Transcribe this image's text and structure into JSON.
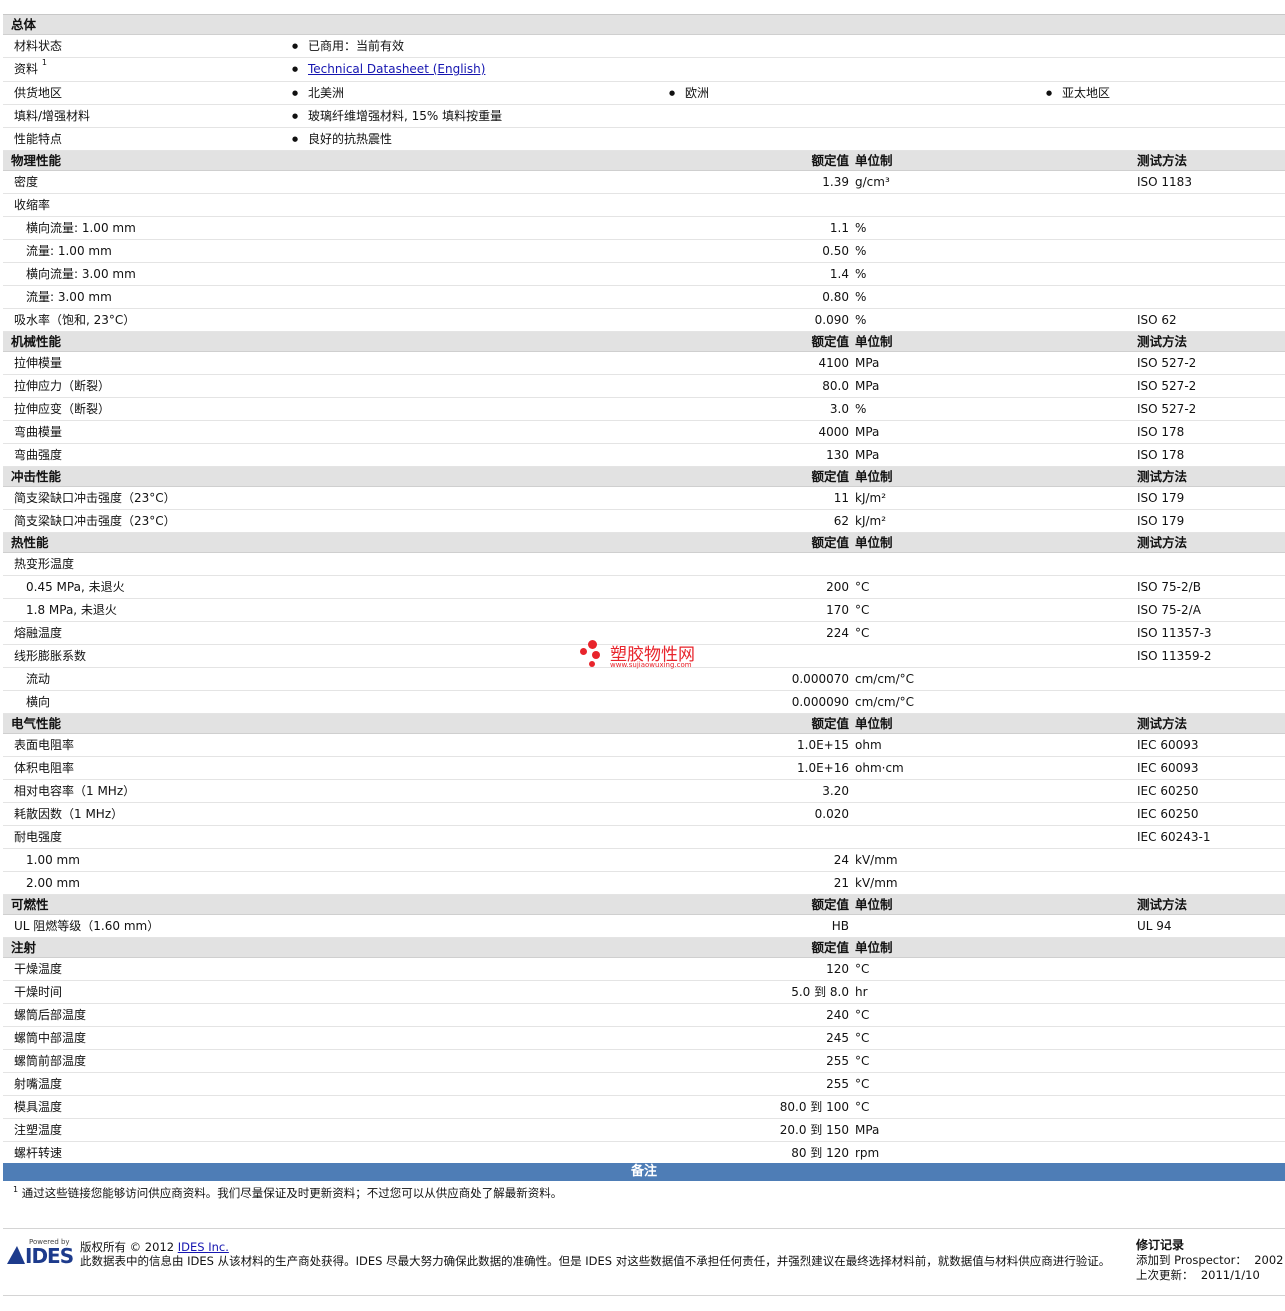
{
  "sections": {
    "general": {
      "title": "总体"
    },
    "material_status": {
      "label": "材料状态",
      "value": "已商用：当前有效"
    },
    "datasheet": {
      "label": "资料",
      "sup": "1",
      "link": "Technical Datasheet (English)"
    },
    "availability": {
      "label": "供货地区",
      "regions": [
        "北美洲",
        "欧洲",
        "亚太地区"
      ]
    },
    "filler": {
      "label": "填料/增强材料",
      "value": "玻璃纤维增强材料, 15% 填料按重量"
    },
    "features": {
      "label": "性能特点",
      "value": "良好的抗热震性"
    }
  },
  "headers": {
    "nominal": "额定值",
    "unit": "单位制",
    "method": "测试方法"
  },
  "groups": [
    {
      "title": "物理性能",
      "rows": [
        {
          "label": "密度",
          "value": "1.39",
          "unit": "g/cm³",
          "method": "ISO 1183"
        },
        {
          "label": "收缩率",
          "value": "",
          "unit": "",
          "method": ""
        },
        {
          "label": "横向流量: 1.00 mm",
          "value": "1.1",
          "unit": "%",
          "method": "",
          "indent": true
        },
        {
          "label": "流量: 1.00 mm",
          "value": "0.50",
          "unit": "%",
          "method": "",
          "indent": true
        },
        {
          "label": "横向流量: 3.00 mm",
          "value": "1.4",
          "unit": "%",
          "method": "",
          "indent": true
        },
        {
          "label": "流量: 3.00 mm",
          "value": "0.80",
          "unit": "%",
          "method": "",
          "indent": true
        },
        {
          "label": "吸水率（饱和, 23°C）",
          "value": "0.090",
          "unit": "%",
          "method": "ISO 62"
        }
      ]
    },
    {
      "title": "机械性能",
      "rows": [
        {
          "label": "拉伸模量",
          "value": "4100",
          "unit": "MPa",
          "method": "ISO 527-2"
        },
        {
          "label": "拉伸应力（断裂）",
          "value": "80.0",
          "unit": "MPa",
          "method": "ISO 527-2"
        },
        {
          "label": "拉伸应变（断裂）",
          "value": "3.0",
          "unit": "%",
          "method": "ISO 527-2"
        },
        {
          "label": "弯曲模量",
          "value": "4000",
          "unit": "MPa",
          "method": "ISO 178"
        },
        {
          "label": "弯曲强度",
          "value": "130",
          "unit": "MPa",
          "method": "ISO 178"
        }
      ]
    },
    {
      "title": "冲击性能",
      "rows": [
        {
          "label": "简支梁缺口冲击强度（23°C）",
          "value": "11",
          "unit": "kJ/m²",
          "method": "ISO 179"
        },
        {
          "label": "简支梁缺口冲击强度（23°C）",
          "value": "62",
          "unit": "kJ/m²",
          "method": "ISO 179"
        }
      ]
    },
    {
      "title": "热性能",
      "rows": [
        {
          "label": "热变形温度",
          "value": "",
          "unit": "",
          "method": ""
        },
        {
          "label": "0.45 MPa, 未退火",
          "value": "200",
          "unit": "°C",
          "method": "ISO 75-2/B",
          "indent": true
        },
        {
          "label": "1.8 MPa, 未退火",
          "value": "170",
          "unit": "°C",
          "method": "ISO 75-2/A",
          "indent": true
        },
        {
          "label": "熔融温度",
          "value": "224",
          "unit": "°C",
          "method": "ISO 11357-3"
        },
        {
          "label": "线形膨胀系数",
          "value": "",
          "unit": "",
          "method": "ISO 11359-2"
        },
        {
          "label": "流动",
          "value": "0.000070",
          "unit": "cm/cm/°C",
          "method": "",
          "indent": true
        },
        {
          "label": "横向",
          "value": "0.000090",
          "unit": "cm/cm/°C",
          "method": "",
          "indent": true
        }
      ]
    },
    {
      "title": "电气性能",
      "rows": [
        {
          "label": "表面电阻率",
          "value": "1.0E+15",
          "unit": "ohm",
          "method": "IEC 60093"
        },
        {
          "label": "体积电阻率",
          "value": "1.0E+16",
          "unit": "ohm·cm",
          "method": "IEC 60093"
        },
        {
          "label": "相对电容率（1 MHz）",
          "value": "3.20",
          "unit": "",
          "method": "IEC 60250"
        },
        {
          "label": "耗散因数（1 MHz）",
          "value": "0.020",
          "unit": "",
          "method": "IEC 60250"
        },
        {
          "label": "耐电强度",
          "value": "",
          "unit": "",
          "method": "IEC 60243-1"
        },
        {
          "label": "1.00 mm",
          "value": "24",
          "unit": "kV/mm",
          "method": "",
          "indent": true
        },
        {
          "label": "2.00 mm",
          "value": "21",
          "unit": "kV/mm",
          "method": "",
          "indent": true
        }
      ]
    },
    {
      "title": "可燃性",
      "rows": [
        {
          "label": "UL 阻燃等级（1.60 mm）",
          "value": "HB",
          "unit": "",
          "method": "UL 94"
        }
      ]
    },
    {
      "title": "注射",
      "no_method": true,
      "rows": [
        {
          "label": "干燥温度",
          "value": "120",
          "unit": "°C",
          "method": ""
        },
        {
          "label": "干燥时间",
          "value": "5.0 到  8.0",
          "unit": "hr",
          "method": ""
        },
        {
          "label": "螺筒后部温度",
          "value": "240",
          "unit": "°C",
          "method": ""
        },
        {
          "label": "螺筒中部温度",
          "value": "245",
          "unit": "°C",
          "method": ""
        },
        {
          "label": "螺筒前部温度",
          "value": "255",
          "unit": "°C",
          "method": ""
        },
        {
          "label": "射嘴温度",
          "value": "255",
          "unit": "°C",
          "method": ""
        },
        {
          "label": "模具温度",
          "value": "80.0 到  100",
          "unit": "°C",
          "method": ""
        },
        {
          "label": "注塑温度",
          "value": "20.0 到  150",
          "unit": "MPa",
          "method": ""
        },
        {
          "label": "螺杆转速",
          "value": "80 到  120",
          "unit": "rpm",
          "method": ""
        }
      ]
    }
  ],
  "notes": {
    "title": "备注",
    "sup": "1",
    "text": "通过这些链接您能够访问供应商资料。我们尽量保证及时更新资料；不过您可以从供应商处了解最新资料。"
  },
  "footer": {
    "powered": "Powered by",
    "logo": "IDES",
    "copyright_prefix": "版权所有  © 2012 ",
    "copyright_link": "IDES Inc.",
    "disclaimer": "此数据表中的信息由  IDES 从该材料的生产商处获得。IDES 尽最大努力确保此数据的准确性。但是  IDES 对这些数据值不承担任何责任，并强烈建议在最终选择材料前，就数据值与材料供应商进行验证。",
    "revision_title": "修订记录",
    "added_label": "添加到 Prospector：",
    "added_value": "2002",
    "updated_label": "上次更新：",
    "updated_value": "2011/1/10"
  },
  "watermark": {
    "text": "塑胶物性网",
    "url": "www.sujiaowuxing.com",
    "color": "#e8242b"
  }
}
